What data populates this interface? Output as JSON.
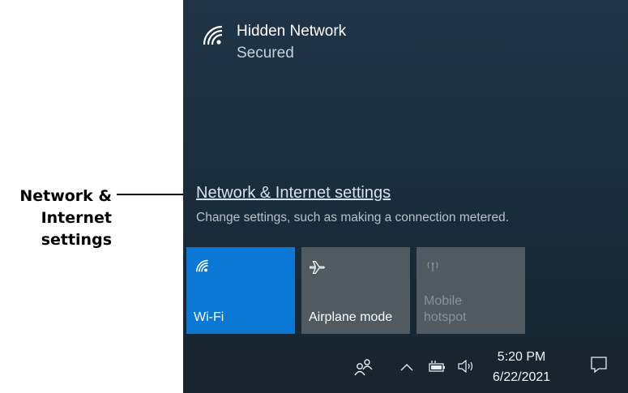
{
  "callout": {
    "text_lines": [
      "Network &",
      "Internet",
      "settings"
    ]
  },
  "network": {
    "name": "Hidden Network",
    "status": "Secured",
    "icon": "wifi-icon"
  },
  "settings": {
    "link": "Network & Internet settings",
    "description": "Change settings, such as making a connection metered."
  },
  "quick_actions": [
    {
      "label": "Wi-Fi",
      "icon": "wifi-icon",
      "active": true
    },
    {
      "label": "Airplane mode",
      "icon": "airplane-icon",
      "active": false
    },
    {
      "label_line1": "Mobile",
      "label_line2": "hotspot",
      "icon": "hotspot-icon",
      "active": false,
      "disabled": true
    }
  ],
  "taskbar": {
    "time": "5:20 PM",
    "date": "6/22/2021",
    "icons": [
      "people-icon",
      "chevron-up-icon",
      "battery-icon",
      "volume-icon",
      "notification-icon"
    ]
  },
  "colors": {
    "accent": "#0a78d4",
    "panel_bg": "#1a2d3d",
    "tile_inactive": "#505a61"
  }
}
